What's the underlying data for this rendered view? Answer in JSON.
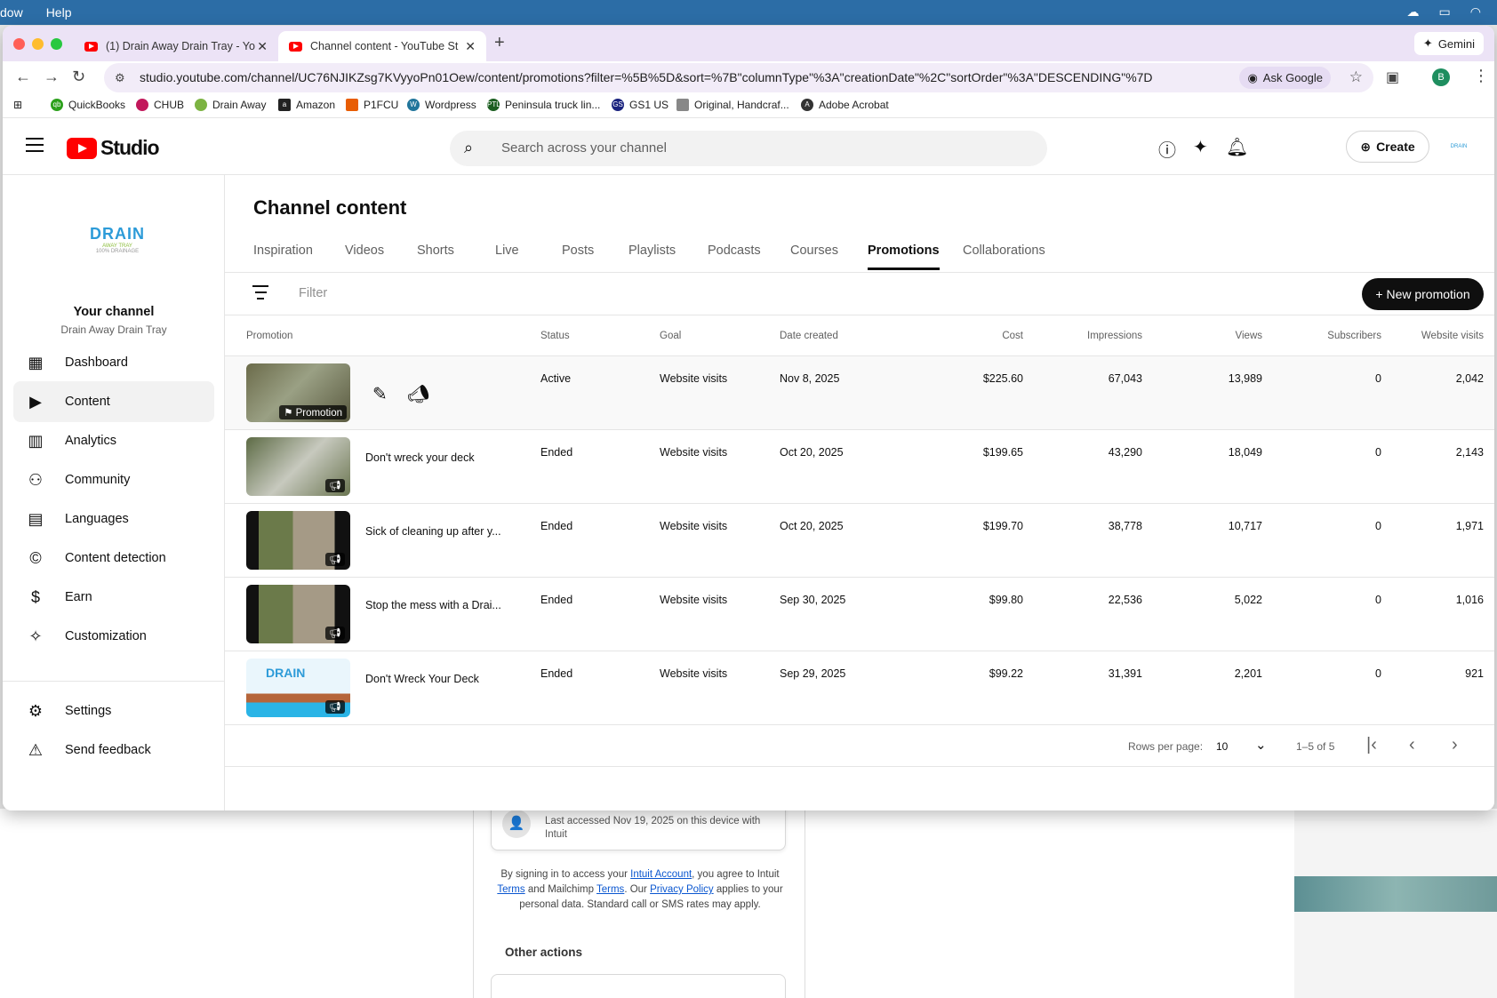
{
  "menubar": {
    "items": [
      "dow",
      "Help"
    ]
  },
  "browser": {
    "tabs": [
      {
        "title": "(1) Drain Away Drain Tray - Yo"
      },
      {
        "title": "Channel content - YouTube St"
      }
    ],
    "new_tab": "+",
    "gemini_label": "Gemini",
    "url": "studio.youtube.com/channel/UC76NJIKZsg7KVyyoPn01Oew/content/promotions?filter=%5B%5D&sort=%7B\"columnType\"%3A\"creationDate\"%2C\"sortOrder\"%3A\"DESCENDING\"%7D",
    "ask_google": "Ask Google",
    "profile_initial": "B",
    "bookmarks": [
      "QuickBooks",
      "CHUB",
      "Drain Away",
      "Amazon",
      "P1FCU",
      "Wordpress",
      "Peninsula truck lin...",
      "GS1 US",
      "Original, Handcraf...",
      "Adobe Acrobat"
    ]
  },
  "studio": {
    "logo_text": "Studio",
    "search_placeholder": "Search across your channel",
    "create_label": "Create",
    "channel_logo_text": "DRAIN",
    "channel_logo_sub": "AWAY TRAY",
    "channel_logo_tagline": "100% DRAINAGE",
    "sidebar": {
      "channel_title": "Your channel",
      "channel_name": "Drain Away Drain Tray",
      "items": [
        {
          "label": "Dashboard",
          "icon": "dashboard-icon"
        },
        {
          "label": "Content",
          "icon": "content-icon",
          "active": true
        },
        {
          "label": "Analytics",
          "icon": "analytics-icon"
        },
        {
          "label": "Community",
          "icon": "community-icon"
        },
        {
          "label": "Languages",
          "icon": "languages-icon"
        },
        {
          "label": "Content detection",
          "icon": "copyright-icon"
        },
        {
          "label": "Earn",
          "icon": "dollar-icon"
        },
        {
          "label": "Customization",
          "icon": "magic-wand-icon"
        }
      ],
      "bottom_items": [
        {
          "label": "Settings",
          "icon": "gear-icon"
        },
        {
          "label": "Send feedback",
          "icon": "feedback-icon"
        }
      ]
    },
    "page_title": "Channel content",
    "content_tabs": [
      "Inspiration",
      "Videos",
      "Shorts",
      "Live",
      "Posts",
      "Playlists",
      "Podcasts",
      "Courses",
      "Promotions",
      "Collaborations"
    ],
    "active_tab": "Promotions",
    "filter_placeholder": "Filter",
    "new_promotion_label": "+ New promotion",
    "columns": [
      "Promotion",
      "Status",
      "Goal",
      "Date created",
      "Cost",
      "Impressions",
      "Views",
      "Subscribers",
      "Website visits"
    ],
    "rows": [
      {
        "title": "",
        "promotion_label": "Promotion",
        "status": "Active",
        "goal": "Website visits",
        "date": "Nov 8, 2025",
        "cost": "$225.60",
        "impressions": "67,043",
        "views": "13,989",
        "subscribers": "0",
        "website_visits": "2,042"
      },
      {
        "title": "Don't wreck your deck",
        "status": "Ended",
        "goal": "Website visits",
        "date": "Oct 20, 2025",
        "cost": "$199.65",
        "impressions": "43,290",
        "views": "18,049",
        "subscribers": "0",
        "website_visits": "2,143"
      },
      {
        "title": "Sick of cleaning up after y...",
        "status": "Ended",
        "goal": "Website visits",
        "date": "Oct 20, 2025",
        "cost": "$199.70",
        "impressions": "38,778",
        "views": "10,717",
        "subscribers": "0",
        "website_visits": "1,971"
      },
      {
        "title": "Stop the mess with a Drai...",
        "status": "Ended",
        "goal": "Website visits",
        "date": "Sep 30, 2025",
        "cost": "$99.80",
        "impressions": "22,536",
        "views": "5,022",
        "subscribers": "0",
        "website_visits": "1,016"
      },
      {
        "title": "Don't Wreck Your Deck",
        "status": "Ended",
        "goal": "Website visits",
        "date": "Sep 29, 2025",
        "cost": "$99.22",
        "impressions": "31,391",
        "views": "2,201",
        "subscribers": "0",
        "website_visits": "921"
      }
    ],
    "pager": {
      "rows_per_page_label": "Rows per page:",
      "rows_per_page": "10",
      "range": "1–5 of 5"
    }
  },
  "background": {
    "account_note": "Last accessed Nov 19, 2025 on this device with Intuit",
    "terms_1": "By signing in to access your",
    "terms_link_account": "Intuit Account",
    "terms_2": ", you agree to Intuit",
    "terms_link_terms": "Terms",
    "terms_3": "and Mailchimp",
    "terms_link_terms2": "Terms",
    "terms_4": ". Our",
    "terms_link_privacy": "Privacy Policy",
    "terms_5": "applies to your personal data. Standard call or SMS rates may apply.",
    "other_actions": "Other actions"
  },
  "colors": {
    "accent": "#ff0000",
    "menubar": "#2c6da6",
    "tabbar": "#ece3f6"
  }
}
